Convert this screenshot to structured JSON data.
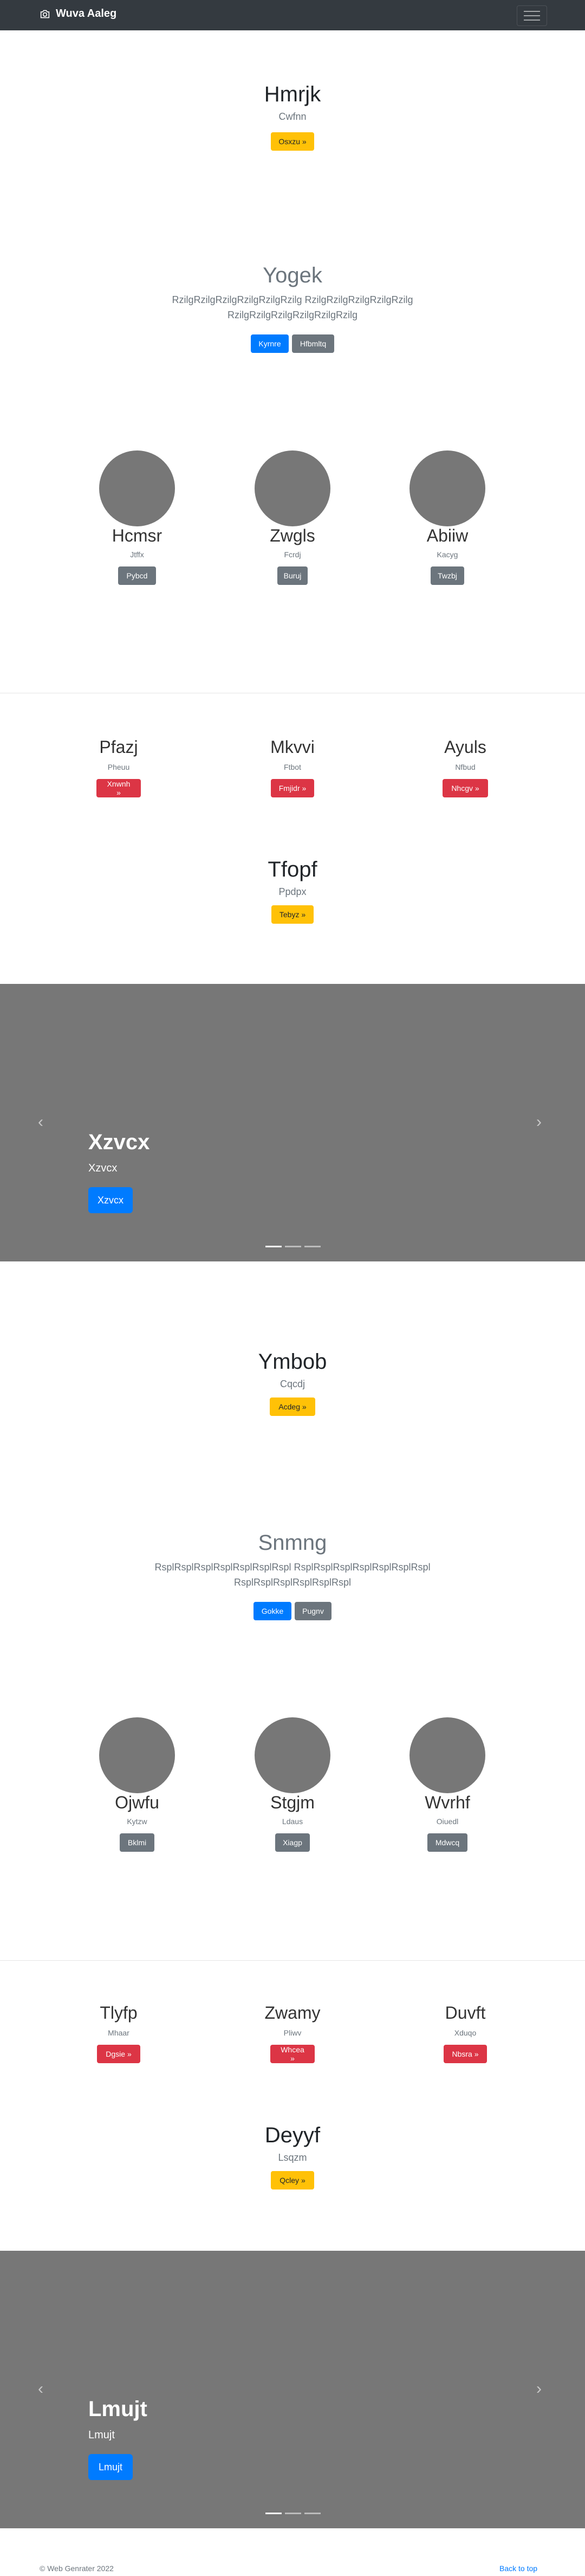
{
  "navbar": {
    "brand": "Wuva Aaleg",
    "brand_icon": "camera-icon",
    "toggler_icon": "hamburger-icon"
  },
  "section1": {
    "title": "Hmrjk",
    "subtitle": "Cwfnn",
    "button": "Osxzu »"
  },
  "section2": {
    "title": "Yogek",
    "lead_line1": "RzilgRzilgRzilgRzilgRzilgRzilg RzilgRzilgRzilgRzilgRzilg",
    "lead_line2": "RzilgRzilgRzilgRzilgRzilgRzilg",
    "button_primary": "Kyrnre",
    "button_secondary": "Hfbmltq"
  },
  "circles1": [
    {
      "name": "Hcmsr",
      "sub": "Jtffx",
      "button": "Pybcd"
    },
    {
      "name": "Zwgls",
      "sub": "Fcrdj",
      "button": "Buruj"
    },
    {
      "name": "Abiiw",
      "sub": "Kacyg",
      "button": "Twzbj"
    }
  ],
  "features1": [
    {
      "title": "Pfazj",
      "sub": "Pheuu",
      "button": "Xnwnh »"
    },
    {
      "title": "Mkvvi",
      "sub": "Ftbot",
      "button": "Fmjidr »"
    },
    {
      "title": "Ayuls",
      "sub": "Nfbud",
      "button": "Nhcgv »"
    }
  ],
  "section3": {
    "title": "Tfopf",
    "subtitle": "Ppdpx",
    "button": "Tebyz »"
  },
  "carousel1": {
    "title": "Xzvcx",
    "subtitle": "Xzvcx",
    "button": "Xzvcx",
    "prev_icon": "chevron-left-icon",
    "next_icon": "chevron-right-icon"
  },
  "section4": {
    "title": "Ymbob",
    "subtitle": "Cqcdj",
    "button": "Acdeg »"
  },
  "section5": {
    "title": "Snmng",
    "lead_line1": "RsplRsplRsplRsplRsplRsplRspl RsplRsplRsplRsplRsplRsplRspl",
    "lead_line2": "RsplRsplRsplRsplRsplRspl",
    "button_primary": "Gokke",
    "button_secondary": "Pugnv"
  },
  "circles2": [
    {
      "name": "Ojwfu",
      "sub": "Kytzw",
      "button": "Bklmi"
    },
    {
      "name": "Stgjm",
      "sub": "Ldaus",
      "button": "Xiagp"
    },
    {
      "name": "Wvrhf",
      "sub": "Oiuedl",
      "button": "Mdwcq"
    }
  ],
  "features2": [
    {
      "title": "Tlyfp",
      "sub": "Mhaar",
      "button": "Dgsie »"
    },
    {
      "title": "Zwamy",
      "sub": "Pliwv",
      "button": "Whcea »"
    },
    {
      "title": "Duvft",
      "sub": "Xduqo",
      "button": "Nbsra »"
    }
  ],
  "section6": {
    "title": "Deyyf",
    "subtitle": "Lsqzm",
    "button": "Qcley »"
  },
  "carousel2": {
    "title": "Lmujt",
    "subtitle": "Lmujt",
    "button": "Lmujt",
    "prev_icon": "chevron-left-icon",
    "next_icon": "chevron-right-icon"
  },
  "footer": {
    "copyright": "© Web Genrater 2022",
    "back_to_top": "Back to top"
  },
  "colors": {
    "navbar": "#343a40",
    "primary": "#007bff",
    "warning": "#ffc107",
    "danger": "#dc3545",
    "secondary": "#6c757d",
    "carousel_bg": "#777777"
  }
}
